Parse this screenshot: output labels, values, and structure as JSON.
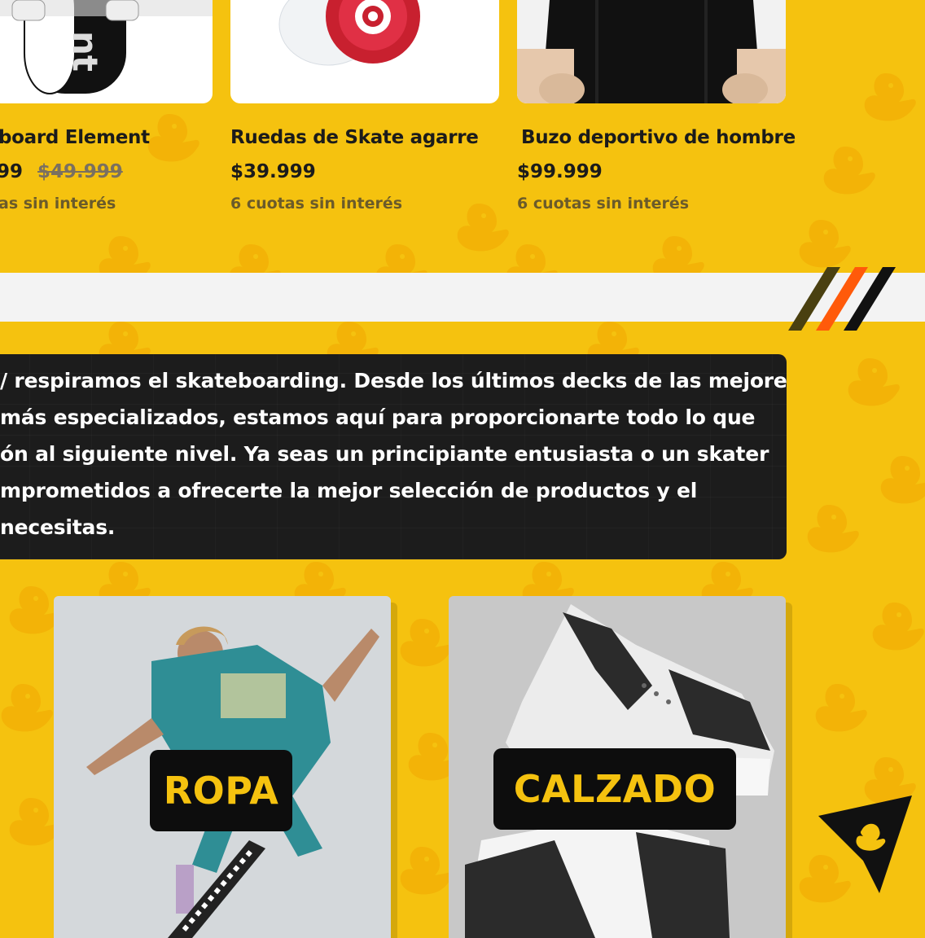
{
  "products": [
    {
      "name": "board Element",
      "price": "99",
      "old_price": "$49.999",
      "installments": "as sin interés"
    },
    {
      "name": "Ruedas de Skate agarre",
      "price": "$39.999",
      "installments": "6 cuotas sin interés"
    },
    {
      "name": "Buzo deportivo de hombre",
      "price": "$99.999",
      "installments": "6 cuotas sin interés"
    }
  ],
  "about": {
    "lines": [
      "/ respiramos el skateboarding. Desde los últimos decks de las mejores",
      " más especializados, estamos aquí para proporcionarte todo lo que",
      "ón al siguiente nivel. Ya seas un principiante entusiasta o un skater",
      "mprometidos a ofrecerte la mejor selección de productos y el",
      "necesitas."
    ]
  },
  "categories": [
    {
      "label": "ROPA"
    },
    {
      "label": "CALZADO"
    }
  ],
  "colors": {
    "background": "#f5c20f",
    "card_label_bg": "#0d0d0d",
    "card_label_text": "#f5c20f",
    "stripe_olive": "#4a4010",
    "stripe_orange": "#ff5a0a",
    "stripe_black": "#111111"
  },
  "icons": [
    "duck-pattern",
    "back-to-top-arrow-icon",
    "duck-icon"
  ]
}
